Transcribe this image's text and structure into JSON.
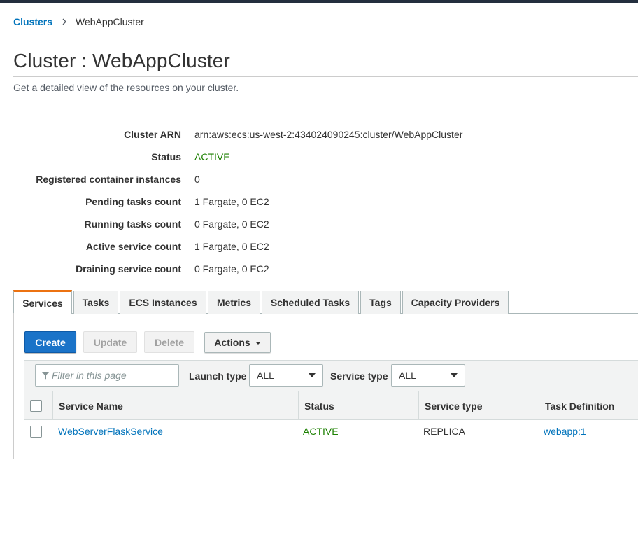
{
  "breadcrumb": {
    "parent": "Clusters",
    "current": "WebAppCluster"
  },
  "page": {
    "title": "Cluster : WebAppCluster",
    "description": "Get a detailed view of the resources on your cluster."
  },
  "details": [
    {
      "label": "Cluster ARN",
      "value": "arn:aws:ecs:us-west-2:434024090245:cluster/WebAppCluster"
    },
    {
      "label": "Status",
      "value": "ACTIVE"
    },
    {
      "label": "Registered container instances",
      "value": "0"
    },
    {
      "label": "Pending tasks count",
      "value": "1 Fargate, 0 EC2"
    },
    {
      "label": "Running tasks count",
      "value": "0 Fargate, 0 EC2"
    },
    {
      "label": "Active service count",
      "value": "1 Fargate, 0 EC2"
    },
    {
      "label": "Draining service count",
      "value": "0 Fargate, 0 EC2"
    }
  ],
  "tabs": [
    {
      "label": "Services",
      "active": true
    },
    {
      "label": "Tasks"
    },
    {
      "label": "ECS Instances"
    },
    {
      "label": "Metrics"
    },
    {
      "label": "Scheduled Tasks"
    },
    {
      "label": "Tags"
    },
    {
      "label": "Capacity Providers"
    }
  ],
  "toolbar": {
    "create_label": "Create",
    "update_label": "Update",
    "delete_label": "Delete",
    "actions_label": "Actions"
  },
  "filters": {
    "search_placeholder": "Filter in this page",
    "launch_type_label": "Launch type",
    "launch_type_value": "ALL",
    "service_type_label": "Service type",
    "service_type_value": "ALL"
  },
  "table": {
    "columns": [
      "Service Name",
      "Status",
      "Service type",
      "Task Definition"
    ],
    "rows": [
      {
        "service_name": "WebServerFlaskService",
        "status": "ACTIVE",
        "service_type": "REPLICA",
        "task_definition": "webapp:1"
      }
    ]
  },
  "colors": {
    "link": "#0073bb",
    "active_status": "#1d8102",
    "primary_button": "#1a73c8",
    "active_tab_accent": "#ec7211",
    "top_bar": "#232f3e"
  }
}
